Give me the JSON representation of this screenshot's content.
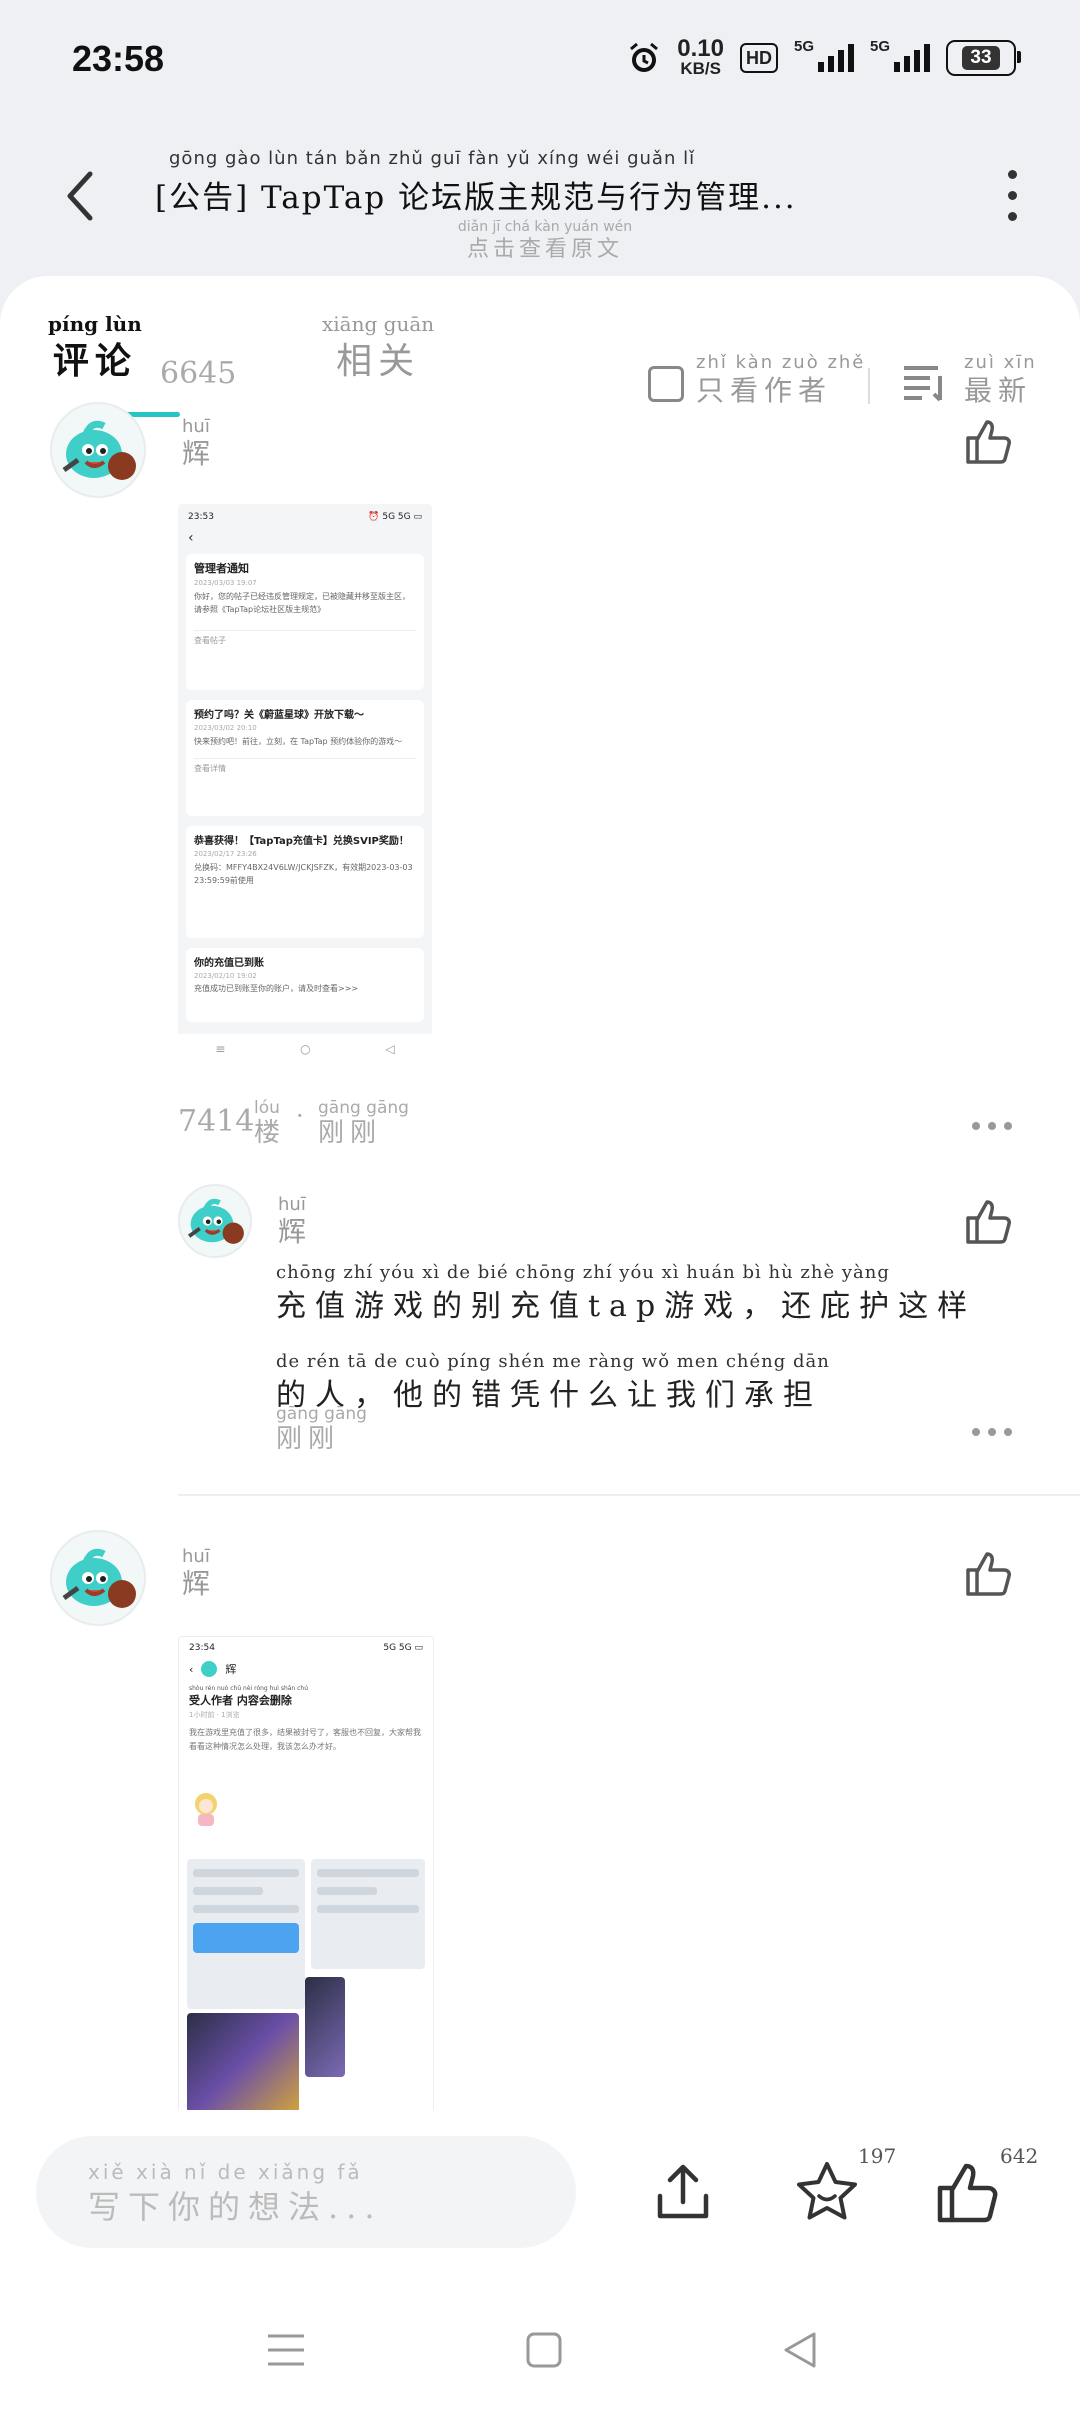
{
  "status": {
    "time": "23:58",
    "net_speed": "0.10",
    "net_unit": "KB/S",
    "hd": "HD",
    "sig1": "5G",
    "sig2": "5G",
    "battery": "33"
  },
  "header": {
    "title_pinyin": "gōng gào                    lùn tán bǎn zhǔ guī fàn  yǔ  xíng wéi guǎn  lǐ",
    "title": "[公告] TapTap 论坛版主规范与行为管理...",
    "original_pinyin": "diǎn  jī  chá kàn yuán wén",
    "original": "点击查看原文"
  },
  "tabs": {
    "comments_py": "píng lùn",
    "comments": "评论",
    "count": "6645",
    "related_py": "xiāng guān",
    "related": "相关",
    "author_only_py": "zhǐ kàn zuò zhě",
    "author_only": "只看作者",
    "latest_py": "zuì xīn",
    "latest": "最新"
  },
  "comments": [
    {
      "name_py": "huī",
      "name": "辉",
      "floor": "7414",
      "floor_unit_py": "lóu",
      "floor_unit": "楼",
      "time_py": "gāng gāng",
      "time": "刚刚",
      "shot": {
        "time": "23:53",
        "icons": "⏰ 5G 5G ▭",
        "cards": [
          {
            "title": "管理者通知",
            "date": "2023/03/03 19:07",
            "body": "你好，您的帖子已经违反管理规定，已被隐藏并移至版主区，请参照《TapTap论坛社区版主规范》",
            "foot": "查看帖子"
          },
          {
            "title": "预约了吗？关《蔚蓝星球》开放下载～",
            "date": "2023/03/02 20:10",
            "body": "快来预约吧！前往，立刻，在 TapTap 预约体验你的游戏～",
            "foot": "查看详情"
          },
          {
            "title": "恭喜获得！【TapTap充值卡】兑换SVIP奖励！",
            "date": "2023/02/17 23:26",
            "body": "兑换码：MFFY4BX24V6LW/JCKJSFZK，有效期2023-03-03 23:59:59前使用",
            "foot": ""
          },
          {
            "title": "你的充值已到账",
            "date": "2023/02/10 19:02",
            "body": "充值成功已到账至你的账户，请及时查看>>>",
            "foot": ""
          }
        ]
      }
    },
    {
      "name_py": "huī",
      "name": "辉",
      "line1_py": "chōng zhí yóu  xì   de  bié chōng zhí          yóu  xì       huán  bì   hù  zhè yàng",
      "line1": "充值游戏的别充值tap游戏，还庇护这样",
      "line2_py": "de  rén          tā   de  cuò píng shén me ràng wǒ men chéng dān",
      "line2": "的人，他的错凭什么让我们承担",
      "time_py": "gāng gāng",
      "time": "刚刚"
    },
    {
      "name_py": "huī",
      "name": "辉",
      "shot": {
        "time": "23:54",
        "icons": "5G 5G ▭",
        "top_name": "辉",
        "heading_py": "shòu rén nuò chū  nèi róng huì shān chú",
        "heading": "受人作者 内容会删除",
        "sub": "1小时前 · 1浏览",
        "body": "我在游戏里充值了很多，结果被封号了，客服也不回复，大家帮我看看这种情况怎么处理，我该怎么办才好。"
      }
    }
  ],
  "bottom": {
    "input_py": "xiě  xià   nǐ   de  xiǎng  fǎ",
    "input_placeholder": "写下你的想法...",
    "star_count": "197",
    "like_count": "642"
  }
}
